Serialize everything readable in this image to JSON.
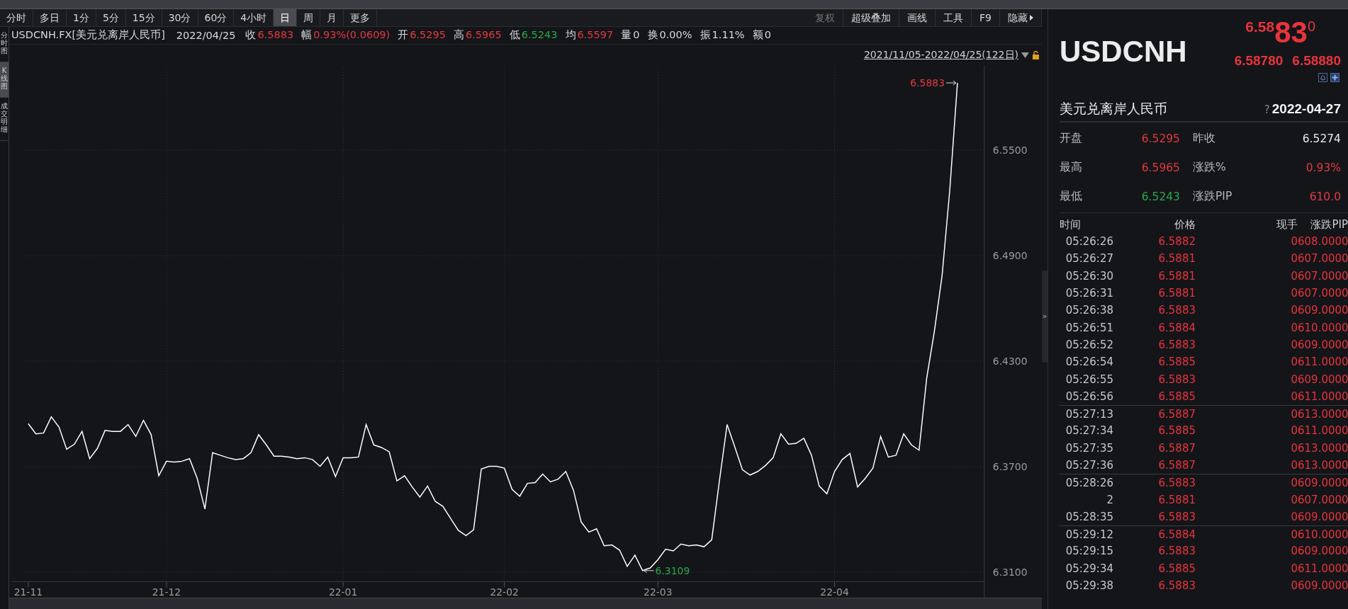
{
  "toolbar": {
    "periods": [
      {
        "label": "分时",
        "selected": false
      },
      {
        "label": "多日",
        "selected": false
      },
      {
        "label": "1分",
        "selected": false
      },
      {
        "label": "5分",
        "selected": false
      },
      {
        "label": "15分",
        "selected": false
      },
      {
        "label": "30分",
        "selected": false
      },
      {
        "label": "60分",
        "selected": false
      },
      {
        "label": "4小时",
        "selected": false
      },
      {
        "label": "日",
        "selected": true
      },
      {
        "label": "周",
        "selected": false
      },
      {
        "label": "月",
        "selected": false
      },
      {
        "label": "更多",
        "selected": false
      }
    ],
    "tools": [
      {
        "label": "复权",
        "disabled": true
      },
      {
        "label": "超级叠加",
        "disabled": false
      },
      {
        "label": "画线",
        "disabled": false
      },
      {
        "label": "工具",
        "disabled": false
      },
      {
        "label": "F9",
        "disabled": false
      },
      {
        "label": "隐藏",
        "disabled": false
      }
    ]
  },
  "side_tabs": [
    {
      "label": "分时图",
      "selected": false
    },
    {
      "label": "K线图",
      "selected": true
    },
    {
      "label": "成交明细",
      "selected": false
    }
  ],
  "quote_line": {
    "symbol": "USDCNH.FX[美元兑离岸人民币]",
    "date": "2022/04/25",
    "fields": [
      {
        "label": "收",
        "value": "6.5883",
        "color": "#e23a3f"
      },
      {
        "label": "幅",
        "value": "0.93%(0.0609)",
        "color": "#e23a3f"
      },
      {
        "label": "开",
        "value": "6.5295",
        "color": "#e23a3f"
      },
      {
        "label": "高",
        "value": "6.5965",
        "color": "#e23a3f"
      },
      {
        "label": "低",
        "value": "6.5243",
        "color": "#2aa84a"
      },
      {
        "label": "均",
        "value": "6.5597",
        "color": "#e23a3f"
      },
      {
        "label": "量",
        "value": "0",
        "color": "#d8d8d8"
      },
      {
        "label": "换",
        "value": "0.00%",
        "color": "#d8d8d8"
      },
      {
        "label": "振",
        "value": "1.11%",
        "color": "#d8d8d8"
      },
      {
        "label": "额",
        "value": "0",
        "color": "#d8d8d8"
      }
    ]
  },
  "chart": {
    "range": "2021/11/05-2022/04/25(122日)",
    "chart_data": {
      "type": "line",
      "grid": true,
      "categories": [
        "21-11",
        null,
        null,
        null,
        null,
        null,
        null,
        null,
        null,
        null,
        null,
        null,
        null,
        null,
        null,
        null,
        null,
        null,
        "21-12",
        null,
        null,
        null,
        null,
        null,
        null,
        null,
        null,
        null,
        null,
        null,
        null,
        null,
        null,
        null,
        null,
        null,
        null,
        null,
        null,
        null,
        null,
        "22-01",
        null,
        null,
        null,
        null,
        null,
        null,
        null,
        null,
        null,
        null,
        null,
        null,
        null,
        null,
        null,
        null,
        null,
        null,
        null,
        null,
        "22-02",
        null,
        null,
        null,
        null,
        null,
        null,
        null,
        null,
        null,
        null,
        null,
        null,
        null,
        null,
        null,
        null,
        null,
        null,
        null,
        "22-03",
        null,
        null,
        null,
        null,
        null,
        null,
        null,
        null,
        null,
        null,
        null,
        null,
        null,
        null,
        null,
        null,
        null,
        null,
        null,
        null,
        null,
        null,
        "22-04",
        null,
        null,
        null,
        null,
        null,
        null,
        null,
        null,
        null,
        null,
        null,
        null,
        null,
        null,
        null,
        null,
        null,
        null,
        null
      ],
      "series": [
        {
          "color": "#ffffff",
          "values": [
            6.3945,
            6.3887,
            6.3892,
            6.3984,
            6.3926,
            6.3799,
            6.3828,
            6.3901,
            6.3746,
            6.3804,
            6.3906,
            6.3901,
            6.3901,
            6.394,
            6.3872,
            6.3964,
            6.3882,
            6.3649,
            6.3731,
            6.3726,
            6.3731,
            6.3746,
            6.3634,
            6.3459,
            6.378,
            6.3765,
            6.3751,
            6.3741,
            6.3746,
            6.378,
            6.3882,
            6.3824,
            6.376,
            6.376,
            6.3755,
            6.3746,
            6.3751,
            6.3741,
            6.3702,
            6.3755,
            6.3644,
            6.3751,
            6.3751,
            6.3755,
            6.394,
            6.3824,
            6.3809,
            6.3785,
            6.3619,
            6.3649,
            6.3585,
            6.3527,
            6.359,
            6.3503,
            6.3474,
            6.3406,
            6.3338,
            6.3308,
            6.3342,
            6.3687,
            6.3702,
            6.3702,
            6.3692,
            6.3571,
            6.3532,
            6.3605,
            6.361,
            6.3658,
            6.3614,
            6.3629,
            6.3673,
            6.3566,
            6.3386,
            6.3328,
            6.3347,
            6.325,
            6.3255,
            6.3226,
            6.3133,
            6.3197,
            6.3109,
            6.3124,
            6.3172,
            6.3231,
            6.3221,
            6.326,
            6.325,
            6.3255,
            6.3245,
            6.3284,
            6.3619,
            6.394,
            6.3814,
            6.3683,
            6.3653,
            6.3673,
            6.3707,
            6.3751,
            6.3887,
            6.3828,
            6.3833,
            6.3862,
            6.3765,
            6.359,
            6.3546,
            6.3673,
            6.3741,
            6.3775,
            6.3585,
            6.3634,
            6.3692,
            6.3872,
            6.3755,
            6.3765,
            6.3887,
            6.3824,
            6.3794,
            6.4203,
            6.447,
            6.4786,
            6.5272,
            6.5883,
            null,
            null,
            null
          ]
        }
      ],
      "ylim": [
        6.3046,
        6.5976
      ],
      "yticks": [
        {
          "value": 6.31,
          "label": "6.3100"
        },
        {
          "value": 6.37,
          "label": "6.3700"
        },
        {
          "value": 6.43,
          "label": "6.4300"
        },
        {
          "value": 6.49,
          "label": "6.4900"
        },
        {
          "value": 6.55,
          "label": "6.5500"
        }
      ]
    },
    "high_label": {
      "text": "6.5883",
      "color": "#e23a3f"
    },
    "low_label": {
      "text": "6.3109",
      "color": "#2aa84a"
    }
  },
  "panel_handle": "»",
  "panel": {
    "symbol": "USDCNH",
    "price": {
      "lead": "6.58",
      "big": "83",
      "tail": "0"
    },
    "bid": "6.58780",
    "ask": "6.58880",
    "name": "美元兑离岸人民币",
    "help": "?",
    "date": "2022-04-27",
    "stats": [
      {
        "label": "开盘",
        "value": "6.5295",
        "color": "#e23a3f"
      },
      {
        "label": "昨收",
        "value": "6.5274",
        "color": "#e8e8e8"
      },
      {
        "label": "最高",
        "value": "6.5965",
        "color": "#e23a3f"
      },
      {
        "label": "涨跌%",
        "value": "0.93%",
        "color": "#e23a3f"
      },
      {
        "label": "最低",
        "value": "6.5243",
        "color": "#2aa84a"
      },
      {
        "label": "涨跌PIP",
        "value": "610.0",
        "color": "#e23a3f"
      }
    ],
    "trades": {
      "columns": [
        "时间",
        "价格",
        "现手",
        "涨跌PIP"
      ],
      "rows": [
        {
          "time": "05:26:26",
          "price": "6.5882",
          "volume": "0",
          "change": "608.0000",
          "separator_above": false
        },
        {
          "time": "05:26:27",
          "price": "6.5881",
          "volume": "0",
          "change": "607.0000",
          "separator_above": false
        },
        {
          "time": "05:26:30",
          "price": "6.5881",
          "volume": "0",
          "change": "607.0000",
          "separator_above": false
        },
        {
          "time": "05:26:31",
          "price": "6.5881",
          "volume": "0",
          "change": "607.0000",
          "separator_above": false
        },
        {
          "time": "05:26:38",
          "price": "6.5883",
          "volume": "0",
          "change": "609.0000",
          "separator_above": false
        },
        {
          "time": "05:26:51",
          "price": "6.5884",
          "volume": "0",
          "change": "610.0000",
          "separator_above": false
        },
        {
          "time": "05:26:52",
          "price": "6.5883",
          "volume": "0",
          "change": "609.0000",
          "separator_above": false
        },
        {
          "time": "05:26:54",
          "price": "6.5885",
          "volume": "0",
          "change": "611.0000",
          "separator_above": false
        },
        {
          "time": "05:26:55",
          "price": "6.5883",
          "volume": "0",
          "change": "609.0000",
          "separator_above": false
        },
        {
          "time": "05:26:56",
          "price": "6.5885",
          "volume": "0",
          "change": "611.0000",
          "separator_above": false
        },
        {
          "time": "05:27:13",
          "price": "6.5887",
          "volume": "0",
          "change": "613.0000",
          "separator_above": true
        },
        {
          "time": "05:27:34",
          "price": "6.5885",
          "volume": "0",
          "change": "611.0000",
          "separator_above": false
        },
        {
          "time": "05:27:35",
          "price": "6.5887",
          "volume": "0",
          "change": "613.0000",
          "separator_above": false
        },
        {
          "time": "05:27:36",
          "price": "6.5887",
          "volume": "0",
          "change": "613.0000",
          "separator_above": false
        },
        {
          "time": "05:28:26",
          "price": "6.5883",
          "volume": "0",
          "change": "609.0000",
          "separator_above": true
        },
        {
          "time": "2",
          "price": "6.5881",
          "volume": "0",
          "change": "607.0000",
          "separator_above": false
        },
        {
          "time": "05:28:35",
          "price": "6.5883",
          "volume": "0",
          "change": "609.0000",
          "separator_above": false
        },
        {
          "time": "05:29:12",
          "price": "6.5884",
          "volume": "0",
          "change": "610.0000",
          "separator_above": true
        },
        {
          "time": "05:29:15",
          "price": "6.5883",
          "volume": "0",
          "change": "609.0000",
          "separator_above": false
        },
        {
          "time": "05:29:34",
          "price": "6.5885",
          "volume": "0",
          "change": "611.0000",
          "separator_above": false
        },
        {
          "time": "05:29:38",
          "price": "6.5883",
          "volume": "0",
          "change": "609.0000",
          "separator_above": false
        }
      ]
    }
  }
}
